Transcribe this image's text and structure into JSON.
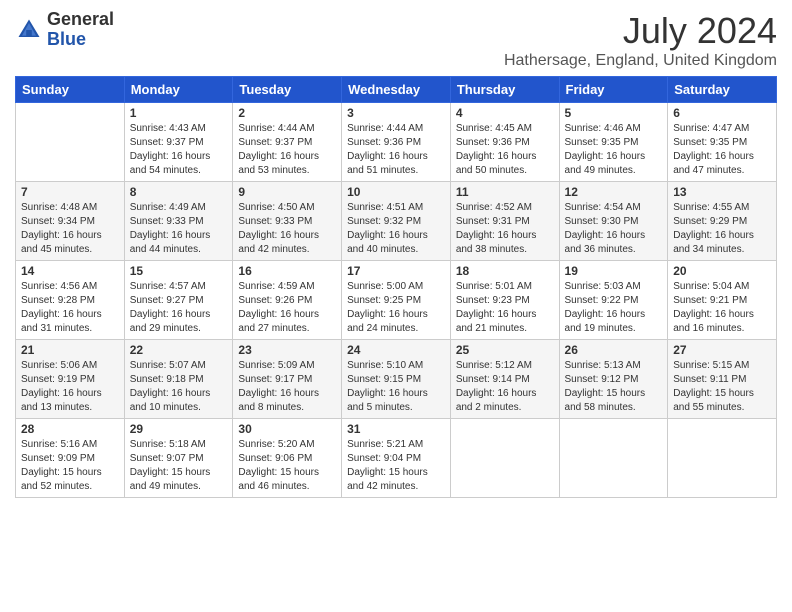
{
  "logo": {
    "general": "General",
    "blue": "Blue"
  },
  "header": {
    "month": "July 2024",
    "location": "Hathersage, England, United Kingdom"
  },
  "weekdays": [
    "Sunday",
    "Monday",
    "Tuesday",
    "Wednesday",
    "Thursday",
    "Friday",
    "Saturday"
  ],
  "weeks": [
    [
      {
        "day": "",
        "info": ""
      },
      {
        "day": "1",
        "info": "Sunrise: 4:43 AM\nSunset: 9:37 PM\nDaylight: 16 hours\nand 54 minutes."
      },
      {
        "day": "2",
        "info": "Sunrise: 4:44 AM\nSunset: 9:37 PM\nDaylight: 16 hours\nand 53 minutes."
      },
      {
        "day": "3",
        "info": "Sunrise: 4:44 AM\nSunset: 9:36 PM\nDaylight: 16 hours\nand 51 minutes."
      },
      {
        "day": "4",
        "info": "Sunrise: 4:45 AM\nSunset: 9:36 PM\nDaylight: 16 hours\nand 50 minutes."
      },
      {
        "day": "5",
        "info": "Sunrise: 4:46 AM\nSunset: 9:35 PM\nDaylight: 16 hours\nand 49 minutes."
      },
      {
        "day": "6",
        "info": "Sunrise: 4:47 AM\nSunset: 9:35 PM\nDaylight: 16 hours\nand 47 minutes."
      }
    ],
    [
      {
        "day": "7",
        "info": "Sunrise: 4:48 AM\nSunset: 9:34 PM\nDaylight: 16 hours\nand 45 minutes."
      },
      {
        "day": "8",
        "info": "Sunrise: 4:49 AM\nSunset: 9:33 PM\nDaylight: 16 hours\nand 44 minutes."
      },
      {
        "day": "9",
        "info": "Sunrise: 4:50 AM\nSunset: 9:33 PM\nDaylight: 16 hours\nand 42 minutes."
      },
      {
        "day": "10",
        "info": "Sunrise: 4:51 AM\nSunset: 9:32 PM\nDaylight: 16 hours\nand 40 minutes."
      },
      {
        "day": "11",
        "info": "Sunrise: 4:52 AM\nSunset: 9:31 PM\nDaylight: 16 hours\nand 38 minutes."
      },
      {
        "day": "12",
        "info": "Sunrise: 4:54 AM\nSunset: 9:30 PM\nDaylight: 16 hours\nand 36 minutes."
      },
      {
        "day": "13",
        "info": "Sunrise: 4:55 AM\nSunset: 9:29 PM\nDaylight: 16 hours\nand 34 minutes."
      }
    ],
    [
      {
        "day": "14",
        "info": "Sunrise: 4:56 AM\nSunset: 9:28 PM\nDaylight: 16 hours\nand 31 minutes."
      },
      {
        "day": "15",
        "info": "Sunrise: 4:57 AM\nSunset: 9:27 PM\nDaylight: 16 hours\nand 29 minutes."
      },
      {
        "day": "16",
        "info": "Sunrise: 4:59 AM\nSunset: 9:26 PM\nDaylight: 16 hours\nand 27 minutes."
      },
      {
        "day": "17",
        "info": "Sunrise: 5:00 AM\nSunset: 9:25 PM\nDaylight: 16 hours\nand 24 minutes."
      },
      {
        "day": "18",
        "info": "Sunrise: 5:01 AM\nSunset: 9:23 PM\nDaylight: 16 hours\nand 21 minutes."
      },
      {
        "day": "19",
        "info": "Sunrise: 5:03 AM\nSunset: 9:22 PM\nDaylight: 16 hours\nand 19 minutes."
      },
      {
        "day": "20",
        "info": "Sunrise: 5:04 AM\nSunset: 9:21 PM\nDaylight: 16 hours\nand 16 minutes."
      }
    ],
    [
      {
        "day": "21",
        "info": "Sunrise: 5:06 AM\nSunset: 9:19 PM\nDaylight: 16 hours\nand 13 minutes."
      },
      {
        "day": "22",
        "info": "Sunrise: 5:07 AM\nSunset: 9:18 PM\nDaylight: 16 hours\nand 10 minutes."
      },
      {
        "day": "23",
        "info": "Sunrise: 5:09 AM\nSunset: 9:17 PM\nDaylight: 16 hours\nand 8 minutes."
      },
      {
        "day": "24",
        "info": "Sunrise: 5:10 AM\nSunset: 9:15 PM\nDaylight: 16 hours\nand 5 minutes."
      },
      {
        "day": "25",
        "info": "Sunrise: 5:12 AM\nSunset: 9:14 PM\nDaylight: 16 hours\nand 2 minutes."
      },
      {
        "day": "26",
        "info": "Sunrise: 5:13 AM\nSunset: 9:12 PM\nDaylight: 15 hours\nand 58 minutes."
      },
      {
        "day": "27",
        "info": "Sunrise: 5:15 AM\nSunset: 9:11 PM\nDaylight: 15 hours\nand 55 minutes."
      }
    ],
    [
      {
        "day": "28",
        "info": "Sunrise: 5:16 AM\nSunset: 9:09 PM\nDaylight: 15 hours\nand 52 minutes."
      },
      {
        "day": "29",
        "info": "Sunrise: 5:18 AM\nSunset: 9:07 PM\nDaylight: 15 hours\nand 49 minutes."
      },
      {
        "day": "30",
        "info": "Sunrise: 5:20 AM\nSunset: 9:06 PM\nDaylight: 15 hours\nand 46 minutes."
      },
      {
        "day": "31",
        "info": "Sunrise: 5:21 AM\nSunset: 9:04 PM\nDaylight: 15 hours\nand 42 minutes."
      },
      {
        "day": "",
        "info": ""
      },
      {
        "day": "",
        "info": ""
      },
      {
        "day": "",
        "info": ""
      }
    ]
  ]
}
